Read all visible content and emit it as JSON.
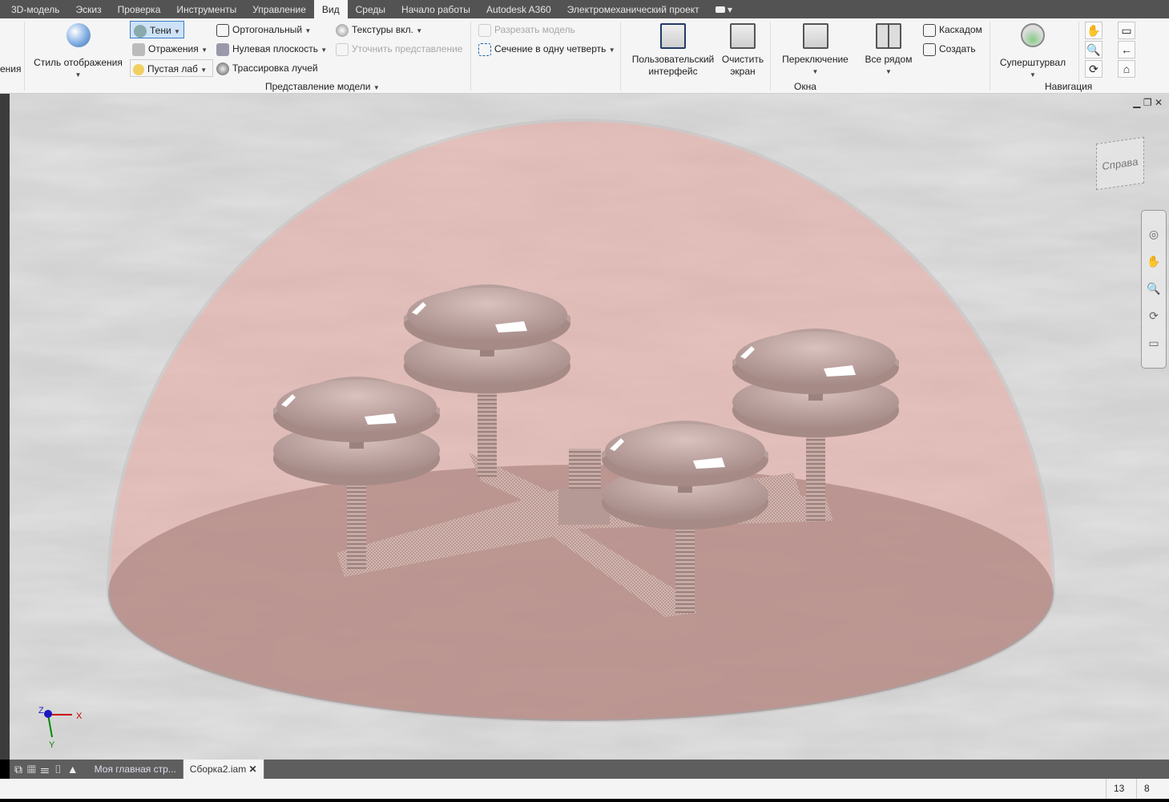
{
  "tabs": [
    "3D-модель",
    "Эскиз",
    "Проверка",
    "Инструменты",
    "Управление",
    "Вид",
    "Среды",
    "Начало работы",
    "Autodesk A360",
    "Электромеханический проект"
  ],
  "active_tab": "Вид",
  "ribbon": {
    "cut_left": "ения",
    "display_style": "Стиль отображения",
    "shadows": "Тени",
    "reflections": "Отражения",
    "lighting": "Пустая лаб",
    "ortho": "Ортогональный",
    "ground_plane": "Нулевая плоскость",
    "ray_tracing": "Трассировка лучей",
    "textures": "Текстуры вкл.",
    "refine": "Уточнить представление",
    "cut_model": "Разрезать модель",
    "quarter_section": "Сечение в одну четверть",
    "group_model": "Представление модели",
    "ui": "Пользовательский интерфейс",
    "clear_screen": "Очистить экран",
    "switch": "Переключение",
    "tile": "Все рядом",
    "cascade": "Каскадом",
    "new": "Создать",
    "group_windows": "Окна",
    "steering": "Суперштурвал",
    "group_nav": "Навигация"
  },
  "viewcube": {
    "face": "Справа"
  },
  "axes": {
    "x": "X",
    "y": "Y",
    "z": "Z"
  },
  "doc_tabs": [
    "Моя главная стр...",
    "Сборка2.iam"
  ],
  "status": {
    "a": "13",
    "b": "8"
  },
  "colors": {
    "tabbar": "#535353",
    "ribbon": "#f5f5f5",
    "dome": "#e8a8a0",
    "accent": "#3d7cc9"
  }
}
